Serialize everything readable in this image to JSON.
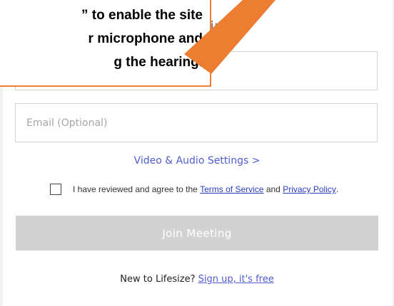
{
  "form": {
    "heading": "ur Meeting!",
    "name_placeholder": "",
    "email_placeholder": "Email (Optional)",
    "settings_link": "Video & Audio Settings >",
    "agree": {
      "prefix": "I have reviewed and agree to the ",
      "terms": "Terms of Service",
      "middle": " and ",
      "privacy": "Privacy Policy",
      "suffix": "."
    },
    "join_button": "Join Meeting",
    "signup": {
      "prompt": "New to Lifesize?",
      "link": "Sign up, it's free"
    }
  },
  "callout": {
    "lines": [
      "” to enable the site",
      "r microphone and",
      "g the hearing."
    ],
    "border_color": "#ed7d31",
    "arrow_color": "#ed7d31",
    "arrow_icon": "arrow-icon"
  },
  "colors": {
    "link": "#4f5cd1",
    "button_disabled": "#d2d2d2"
  }
}
